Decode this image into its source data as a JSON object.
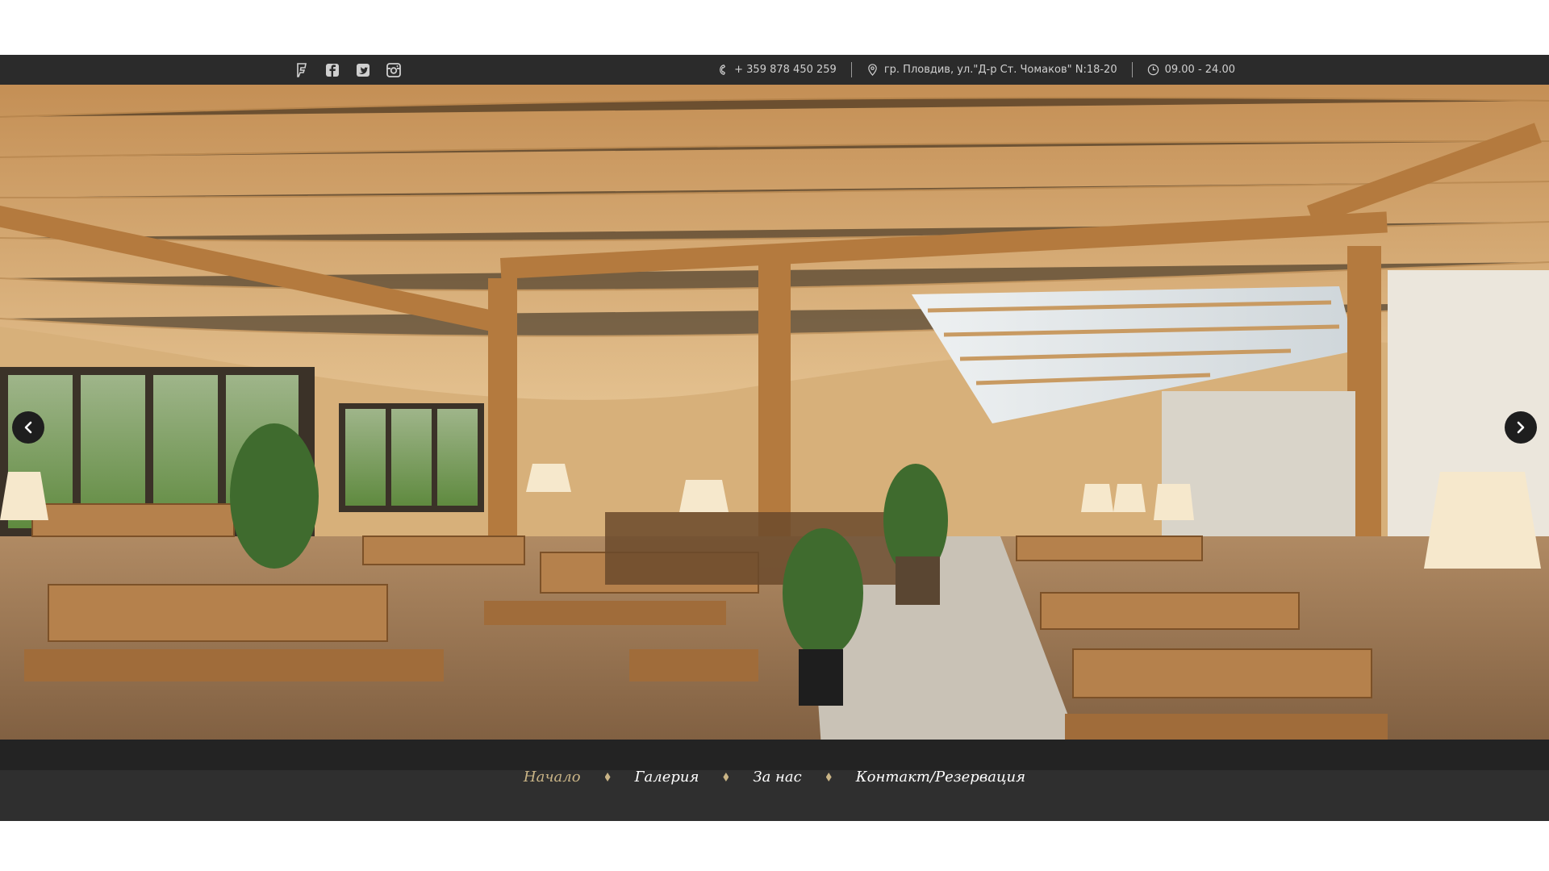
{
  "topbar": {
    "social": [
      {
        "name": "foursquare-icon"
      },
      {
        "name": "facebook-icon"
      },
      {
        "name": "twitter-icon"
      },
      {
        "name": "instagram-icon"
      }
    ],
    "phone": "+ 359 878 450 259",
    "address": "гр. Пловдив, ул.\"Д-р Ст. Чомаков\" N:18-20",
    "hours": "09.00 - 24.00"
  },
  "slider": {
    "prev_icon": "chevron-left-icon",
    "next_icon": "chevron-right-icon"
  },
  "nav": {
    "items": [
      "Начало",
      "Галерия",
      "За нас",
      "Контакт/Резервация"
    ],
    "active": "Начало"
  },
  "colors": {
    "bar": "#2b2b2b",
    "accent": "#c9b486",
    "text": "#ffffff"
  }
}
